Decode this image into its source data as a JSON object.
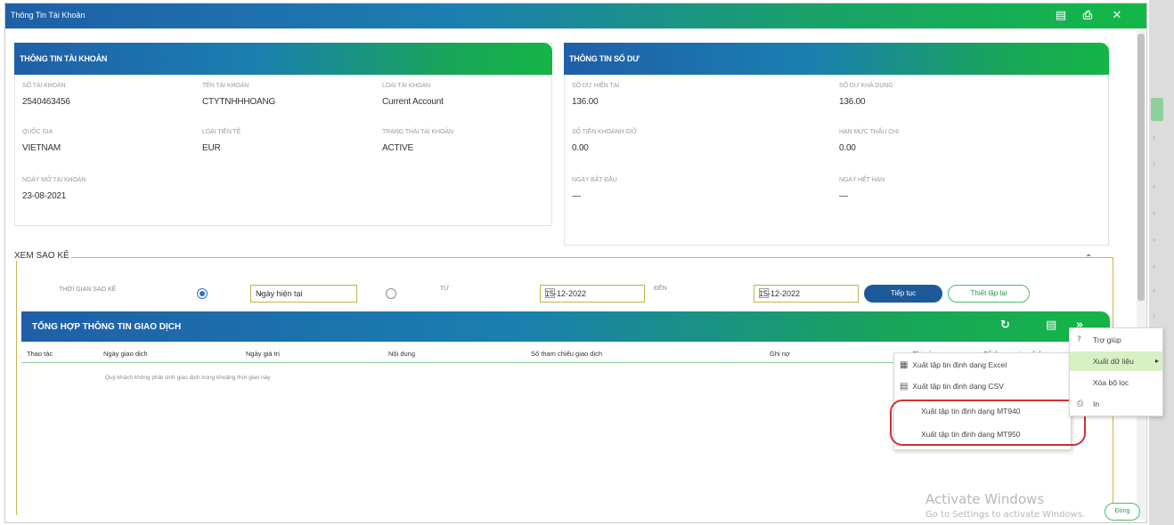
{
  "window": {
    "title": "Thông Tin Tài Khoản",
    "icons": [
      "file-icon",
      "print-icon",
      "close-icon"
    ]
  },
  "account_panel": {
    "header": "THÔNG TIN TÀI KHOẢN",
    "fields": [
      {
        "label": "SỐ TÀI KHOẢN",
        "value": "2540463456"
      },
      {
        "label": "TÊN TÀI KHOẢN",
        "value": "CTYTNHHHOANG"
      },
      {
        "label": "LOẠI TÀI KHOẢN",
        "value": "Current Account"
      },
      {
        "label": "QUỐC GIA",
        "value": "VIETNAM"
      },
      {
        "label": "LOẠI TIỀN TỆ",
        "value": "EUR"
      },
      {
        "label": "TRẠNG THÁI TÀI KHOẢN",
        "value": "ACTIVE"
      },
      {
        "label": "NGÀY MỞ TÀI KHOẢN",
        "value": "23-08-2021"
      }
    ]
  },
  "balance_panel": {
    "header": "THÔNG TIN SỐ DƯ",
    "fields": [
      {
        "label": "SỐ DƯ HIỆN TẠI",
        "value": "136.00"
      },
      {
        "label": "SỐ DƯ KHẢ DỤNG",
        "value": "136.00"
      },
      {
        "label": "SỐ TIỀN KHOANH GIỮ",
        "value": "0.00"
      },
      {
        "label": "HẠN MỨC THẤU CHI",
        "value": "0.00"
      },
      {
        "label": "NGÀY BẮT ĐẦU",
        "value": "—"
      },
      {
        "label": "NGÀY HẾT HẠN",
        "value": "—"
      }
    ]
  },
  "statement": {
    "legend": "XEM SAO KÊ",
    "period_label": "THỜI GIAN SAO KÊ",
    "period_select": "Ngày hiện tại",
    "from_label": "TỪ",
    "from_date": "15-12-2022",
    "to_label": "ĐẾN",
    "to_date": "15-12-2022",
    "continue_button": "Tiếp tục",
    "reset_button": "Thiết lập lại"
  },
  "transactions": {
    "header": "TỔNG HỢP THÔNG TIN GIAO DỊCH",
    "columns": [
      "Thao tác",
      "Ngày giao dịch",
      "Ngày giá trị",
      "Nội dung",
      "Số tham chiếu giao dịch",
      "Ghi nợ",
      "Ghi có",
      "Số dư sau giao dịch"
    ],
    "empty_message": "Quý khách không phát sinh giao dịch trong khoảng thời gian này"
  },
  "export_menu": {
    "items": [
      {
        "icon": "excel-icon",
        "label": "Xuất tập tin định dạng Excel"
      },
      {
        "icon": "csv-icon",
        "label": "Xuất tập tin định dạng CSV"
      },
      {
        "icon": "",
        "label": "Xuất tập tin định dạng MT940"
      },
      {
        "icon": "",
        "label": "Xuất tập tin định dạng MT950"
      }
    ]
  },
  "context_menu": {
    "items": [
      {
        "icon": "help-icon",
        "label": "Trợ giúp"
      },
      {
        "icon": "",
        "label": "Xuất dữ liệu"
      },
      {
        "icon": "",
        "label": "Xóa bộ lọc"
      },
      {
        "icon": "print-icon",
        "label": "In"
      }
    ]
  },
  "watermark": {
    "line1": "Activate Windows",
    "line2": "Go to Settings to activate Windows."
  },
  "close_button": "Đóng"
}
